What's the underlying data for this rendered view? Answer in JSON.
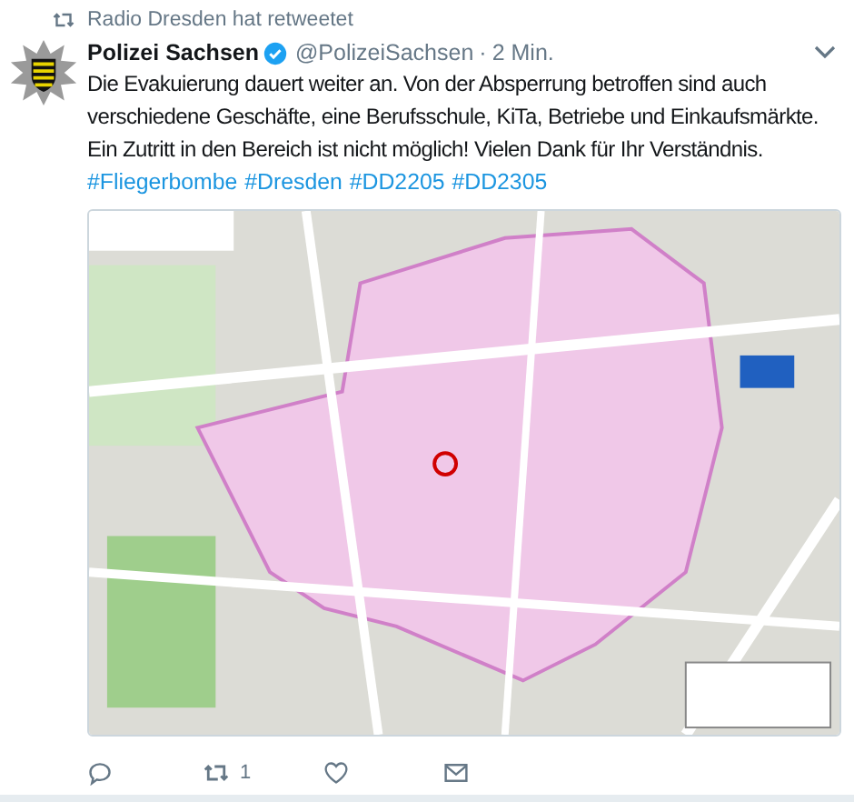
{
  "retweet_notice": "Radio Dresden hat retweetet",
  "tweet": {
    "author": "Polizei Sachsen",
    "verified": true,
    "handle": "@PolizeiSachsen",
    "separator": "·",
    "time": "2 Min.",
    "text": "Die Evakuierung dauert weiter an. Von der Absperrung betroffen sind auch verschiedene Geschäfte, eine Berufsschule, KiTa, Betriebe und Einkaufsmärkte. Ein Zutritt in den Bereich ist nicht möglich! Vielen Dank für Ihr Verständnis.",
    "hashtags": [
      "#Fliegerbombe",
      "#Dresden",
      "#DD2205",
      "#DD2305"
    ],
    "actions": [
      {
        "kind": "reply"
      },
      {
        "kind": "retweet",
        "count": "1"
      },
      {
        "kind": "like"
      },
      {
        "kind": "message"
      }
    ]
  }
}
